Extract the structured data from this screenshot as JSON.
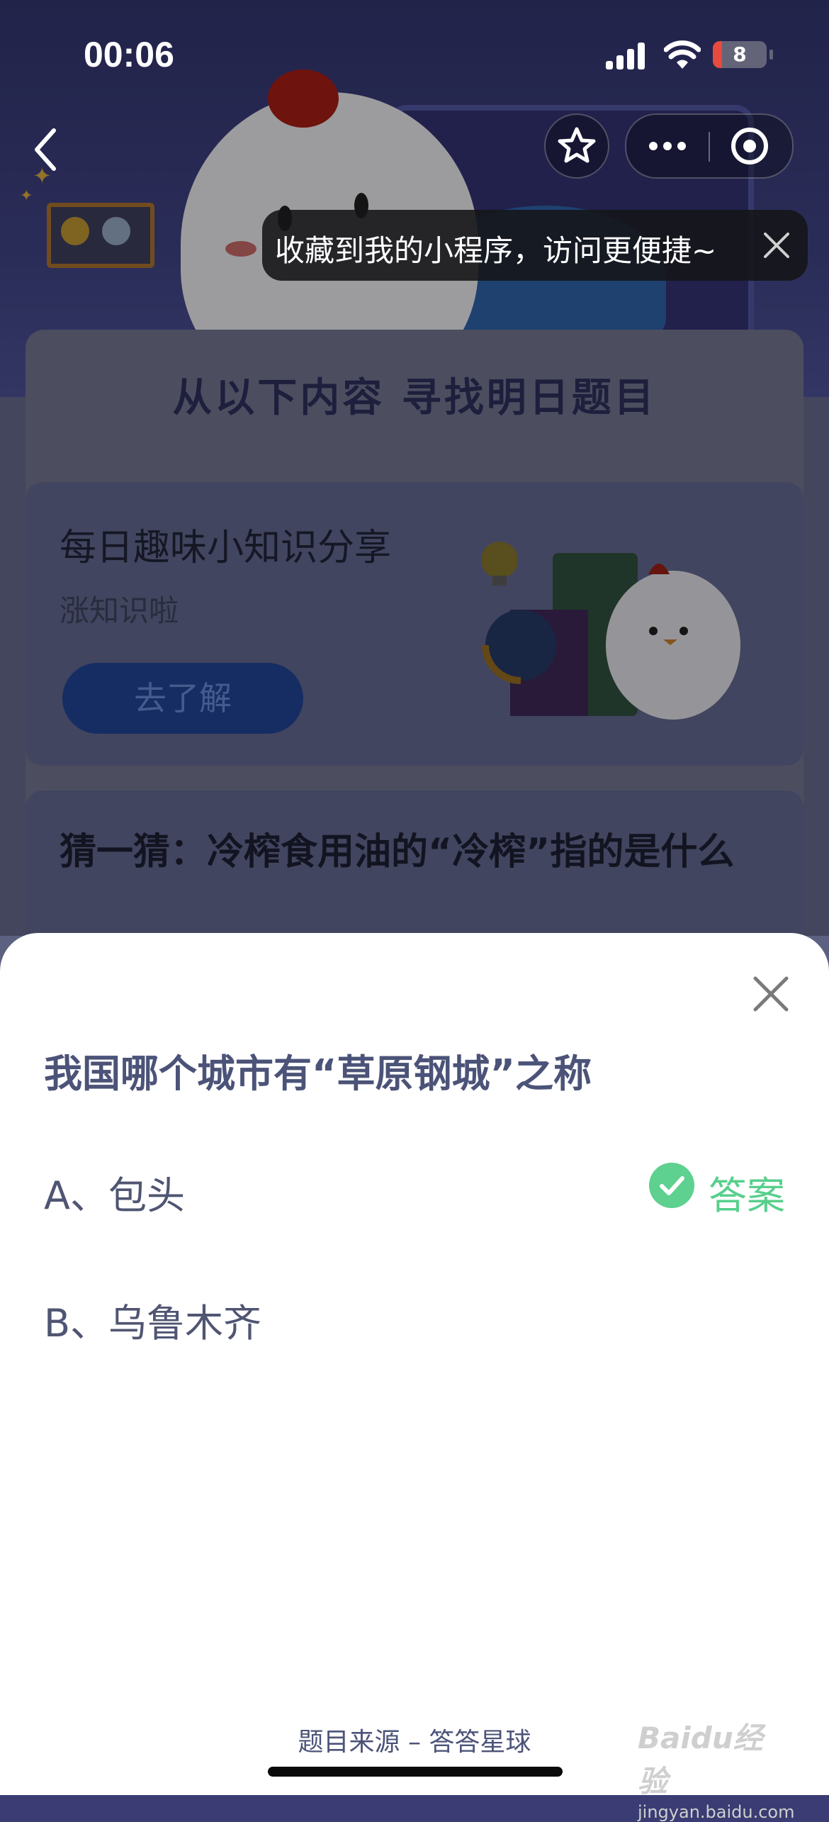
{
  "status_bar": {
    "time": "00:06",
    "battery": "8",
    "battery_level": 0.08,
    "battery_color": "#e84a3e"
  },
  "nav": {
    "back_icon": "chevron-left-icon",
    "favorite_icon": "star-outline-icon",
    "more_icon": "more-dots-icon",
    "close_target_icon": "target-circle-icon"
  },
  "tooltip": {
    "text": "收藏到我的小程序，访问更便捷~",
    "close_icon": "close-icon"
  },
  "background_page": {
    "section_title": "从以下内容 寻找明日题目",
    "knowledge_card": {
      "title": "每日趣味小知识分享",
      "subtitle": "涨知识啦",
      "button": "去了解"
    },
    "guess": "猜一猜：冷榨食用油的“冷榨”指的是什么"
  },
  "sheet": {
    "question": "我国哪个城市有“草原钢城”之称",
    "options": [
      {
        "label": "A、包头",
        "is_answer": true
      },
      {
        "label": "B、乌鲁木齐",
        "is_answer": false
      }
    ],
    "answer_label": "答案",
    "answer_color": "#58cf8c",
    "source": "题目来源 – 答答星球"
  },
  "watermark": {
    "main": "Baidu经验",
    "sub": "jingyan.baidu.com"
  }
}
